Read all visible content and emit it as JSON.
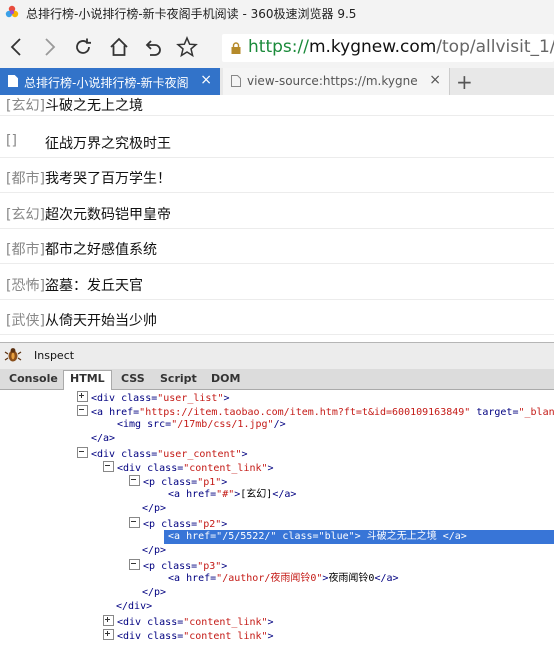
{
  "window": {
    "title": "总排行榜-小说排行榜-新卡夜阁手机阅读 - 360极速浏览器 9.5"
  },
  "address": {
    "proto": "https://",
    "host": "m.kygnew.com",
    "path": "/top/allvisit_1/"
  },
  "tabs": [
    {
      "label": "总排行榜-小说排行榜-新卡夜阁",
      "close": "×"
    },
    {
      "label": "view-source:https://m.kygnew",
      "close": "×"
    }
  ],
  "new_tab": "+",
  "list": [
    {
      "cat": "[玄幻]",
      "title": "斗破之无上之境"
    },
    {
      "cat": "[]",
      "title": "征战万界之究极时王"
    },
    {
      "cat": "[都市]",
      "title": "我考哭了百万学生！"
    },
    {
      "cat": "[玄幻]",
      "title": "超次元数码铠甲皇帝"
    },
    {
      "cat": "[都市]",
      "title": "都市之好感值系统"
    },
    {
      "cat": "[恐怖]",
      "title": "盗墓：发丘天官"
    },
    {
      "cat": "[武侠]",
      "title": "从倚天开始当少帅"
    }
  ],
  "firebug": {
    "inspect": "Inspect",
    "tabs": [
      "Console",
      "HTML",
      "CSS",
      "Script",
      "DOM"
    ],
    "tree": {
      "l1": {
        "tag_open": "<div ",
        "attr": "class=",
        "val": "\"user_list\"",
        "end": ">"
      },
      "l2": {
        "tag_open": "<a ",
        "attr1": "href=",
        "val1": "\"https://item.taobao.com/item.htm?ft=t&id=600109163849\"",
        "attr2": " target=",
        "val2": "\"_blank\"",
        "end": ">"
      },
      "l3": {
        "tag_open": "<img ",
        "attr": "src=",
        "val": "\"/17mb/css/1.jpg\"",
        "end": "/>"
      },
      "l4": {
        "text": "</a>"
      },
      "l5": {
        "tag_open": "<div ",
        "attr": "class=",
        "val": "\"user_content\"",
        "end": ">"
      },
      "l6": {
        "tag_open": "<div ",
        "attr": "class=",
        "val": "\"content_link\"",
        "end": ">"
      },
      "l7": {
        "tag_open": "<p ",
        "attr": "class=",
        "val": "\"p1\"",
        "end": ">"
      },
      "l8": {
        "tag_open": "<a ",
        "attr": "href=",
        "val": "\"#\"",
        "end": ">",
        "text": "[玄幻]",
        "close": "</a>"
      },
      "l9": {
        "text": "</p>"
      },
      "l10": {
        "tag_open": "<p ",
        "attr": "class=",
        "val": "\"p2\"",
        "end": ">"
      },
      "l11": {
        "tag_open": "<a ",
        "attr1": "href=",
        "val1": "\"/5/5522/\"",
        "attr2": " class=",
        "val2": "\"blue\"",
        "end": ">",
        "text": " 斗破之无上之境 ",
        "close": "</a>"
      },
      "l12": {
        "text": "</p>"
      },
      "l13": {
        "tag_open": "<p ",
        "attr": "class=",
        "val": "\"p3\"",
        "end": ">"
      },
      "l14": {
        "tag_open": "<a ",
        "attr": "href=",
        "val": "\"/author/夜雨闻铃0\"",
        "end": ">",
        "text": "夜雨闻铃0",
        "close": "</a>"
      },
      "l15": {
        "text": "</p>"
      },
      "l16": {
        "text": "</div>"
      },
      "l17": {
        "tag_open": "<div ",
        "attr": "class=",
        "val": "\"content_link\"",
        "end": ">"
      },
      "l18": {
        "tag_open": "<div ",
        "attr": "class=",
        "val": "\"content link\"",
        "end": ">"
      }
    }
  }
}
